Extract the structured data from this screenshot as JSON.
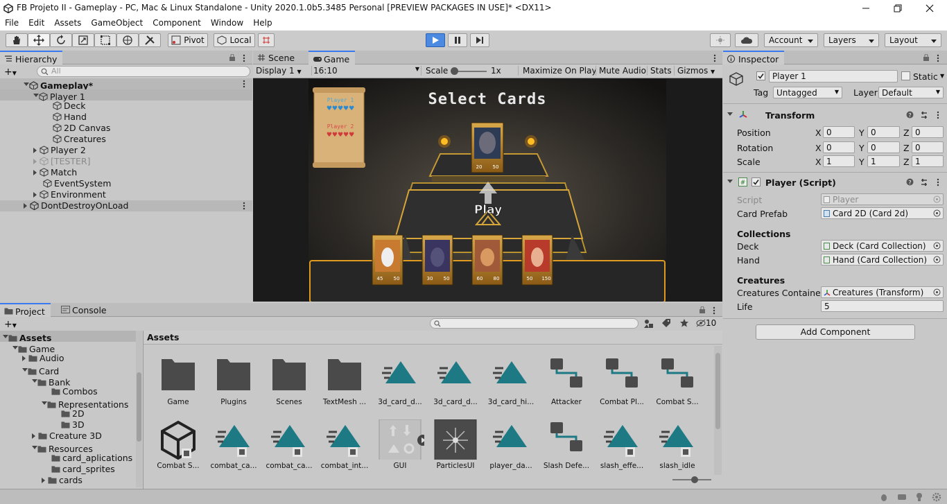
{
  "window": {
    "title": "FB Projeto II - Gameplay - PC, Mac & Linux Standalone - Unity 2020.1.0b5.3485 Personal [PREVIEW PACKAGES IN USE]* <DX11>"
  },
  "menu": [
    "File",
    "Edit",
    "Assets",
    "GameObject",
    "Component",
    "Window",
    "Help"
  ],
  "toolbar": {
    "pivot": "Pivot",
    "local": "Local",
    "account": "Account",
    "layers": "Layers",
    "layout": "Layout"
  },
  "hierarchy": {
    "tab": "Hierarchy",
    "search_placeholder": "All",
    "rows": [
      {
        "label": "Gameplay*",
        "bold": true
      },
      {
        "label": "Player 1"
      },
      {
        "label": "Deck"
      },
      {
        "label": "Hand"
      },
      {
        "label": "2D Canvas"
      },
      {
        "label": "Creatures"
      },
      {
        "label": "Player 2"
      },
      {
        "label": "[TESTER]",
        "disabled": true
      },
      {
        "label": "Match"
      },
      {
        "label": "EventSystem"
      },
      {
        "label": "Environment"
      },
      {
        "label": "DontDestroyOnLoad"
      }
    ]
  },
  "game": {
    "tabs": [
      "Scene",
      "Game"
    ],
    "display": "Display 1",
    "aspect": "16:10",
    "scale_label": "Scale",
    "scale_value": "1x",
    "buttons": [
      "Maximize On Play",
      "Mute Audio",
      "Stats",
      "Gizmos"
    ],
    "scene": {
      "title": "Select Cards",
      "play": "Play",
      "player1": "Player 1",
      "player2": "Player 2",
      "top_card": {
        "atk": "20",
        "hp": "50"
      },
      "hand": [
        {
          "atk": "45",
          "hp": "50"
        },
        {
          "atk": "30",
          "hp": "50"
        },
        {
          "atk": "60",
          "hp": "80"
        },
        {
          "atk": "50",
          "hp": "150"
        }
      ]
    }
  },
  "project": {
    "tabs": [
      "Project",
      "Console"
    ],
    "tree": [
      {
        "label": "Assets",
        "bold": true
      },
      {
        "label": "Game"
      },
      {
        "label": "Audio"
      },
      {
        "label": "Card"
      },
      {
        "label": "Bank"
      },
      {
        "label": "Combos"
      },
      {
        "label": "Representations"
      },
      {
        "label": "2D"
      },
      {
        "label": "3D"
      },
      {
        "label": "Creature 3D"
      },
      {
        "label": "Resources"
      },
      {
        "label": "card_aplications"
      },
      {
        "label": "card_sprites"
      },
      {
        "label": "cards"
      }
    ],
    "breadcrumb": "Assets",
    "hidden_count": "10",
    "assets_row1": [
      {
        "name": "Game",
        "type": "folder"
      },
      {
        "name": "Plugins",
        "type": "folder"
      },
      {
        "name": "Scenes",
        "type": "folder"
      },
      {
        "name": "TextMesh ...",
        "type": "folder"
      },
      {
        "name": "3d_card_d...",
        "type": "anim"
      },
      {
        "name": "3d_card_d...",
        "type": "anim"
      },
      {
        "name": "3d_card_hi...",
        "type": "anim"
      },
      {
        "name": "Attacker",
        "type": "graph"
      },
      {
        "name": "Combat Pl...",
        "type": "graph"
      },
      {
        "name": "Combat S...",
        "type": "graph"
      }
    ],
    "assets_row2": [
      {
        "name": "Combat S...",
        "type": "unity"
      },
      {
        "name": "combat_ca...",
        "type": "animsub"
      },
      {
        "name": "combat_ca...",
        "type": "animsub"
      },
      {
        "name": "combat_int...",
        "type": "animsub"
      },
      {
        "name": "GUI",
        "type": "gui"
      },
      {
        "name": "ParticlesUI",
        "type": "particles"
      },
      {
        "name": "player_da...",
        "type": "anim"
      },
      {
        "name": "Slash Defe...",
        "type": "graph"
      },
      {
        "name": "slash_effe...",
        "type": "animsub"
      },
      {
        "name": "slash_idle",
        "type": "animsub"
      }
    ]
  },
  "inspector": {
    "tab": "Inspector",
    "object_name": "Player 1",
    "static_label": "Static",
    "tag_label": "Tag",
    "tag_value": "Untagged",
    "layer_label": "Layer",
    "layer_value": "Default",
    "transform": {
      "title": "Transform",
      "rows": [
        {
          "label": "Position",
          "x": "0",
          "y": "0",
          "z": "0"
        },
        {
          "label": "Rotation",
          "x": "0",
          "y": "0",
          "z": "0"
        },
        {
          "label": "Scale",
          "x": "1",
          "y": "1",
          "z": "1"
        }
      ]
    },
    "player_script": {
      "title": "Player (Script)",
      "script_label": "Script",
      "script_value": "Player",
      "card_prefab_label": "Card Prefab",
      "card_prefab_value": "Card 2D (Card 2d)",
      "collections_header": "Collections",
      "deck_label": "Deck",
      "deck_value": "Deck (Card Collection)",
      "hand_label": "Hand",
      "hand_value": "Hand (Card Collection)",
      "creatures_header": "Creatures",
      "container_label": "Creatures Container",
      "container_value": "Creatures (Transform)",
      "life_label": "Life",
      "life_value": "5"
    },
    "add_component": "Add Component"
  }
}
